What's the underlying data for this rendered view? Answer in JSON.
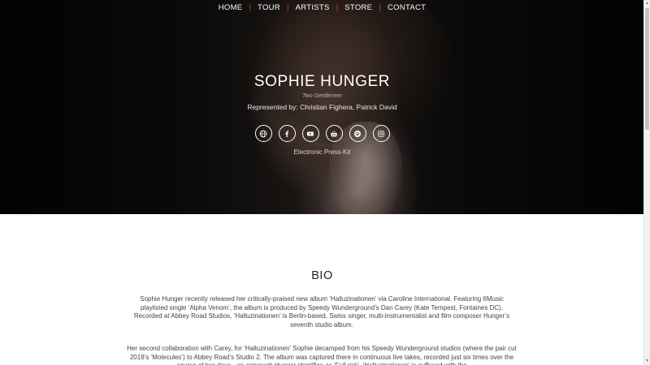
{
  "nav": {
    "items": [
      "HOME",
      "TOUR",
      "ARTISTS",
      "STORE",
      "CONTACT"
    ]
  },
  "hero": {
    "title": "SOPHIE HUNGER",
    "subtitle": "Two Gentlemen",
    "represented": "Represented by: Christian Fighera, Patrick David",
    "epk": "Electronic Press-Kit",
    "social_icons": [
      "globe-icon",
      "facebook-icon",
      "youtube-icon",
      "shop-basket-icon",
      "spotify-icon",
      "instagram-icon"
    ]
  },
  "bio": {
    "heading": "BIO",
    "p1": "Sophie Hunger recently released her critically-praised new album ‘Halluzinationen’ via Caroline International. Featuring 6Music playlisted single ‘Alpha Venom’, the album is produced by Speedy Wunderground’s Dan Carey (Kate Tempest, Fontaines DC). Recorded at Abbey Road Studios, ‘Halluzinationen’ is Berlin-based, Swiss singer, multi-instrumentalist and film composer Hunger’s seventh studio album.",
    "p2": "Her second collaboration with Carey, for ‘Halluzinationen’ Sophie decamped from his Speedy Wunderground studios (where the pair cut 2018’s ‘Molecules’) to Abbey Road’s Studio 2. The album was captured there in continuous live takes, recorded just six times over the course of two days - an approach Hunger identifies as ‘Full risk’. ‘Halluzinationen’ is suffused with the"
  },
  "colors": {
    "nav_separator": "#c0392b",
    "hero_bg": "#050505",
    "text_dark": "#222222"
  }
}
